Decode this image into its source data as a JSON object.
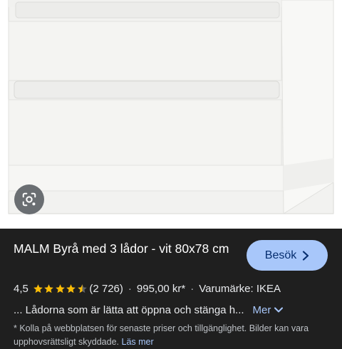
{
  "product": {
    "title": "MALM Byrå med 3 lådor - vit 80x78 cm",
    "visit_label": "Besök",
    "rating": "4,5",
    "rating_value": 4.5,
    "rating_max": 5,
    "review_count": "(2 726)",
    "separator": "·",
    "price": "995,00 kr*",
    "brand": "Varumärke: IKEA",
    "snippet": "... Lådorna som är lätta att öppna och stänga h...",
    "more_label": "Mer",
    "disclaimer": "* Kolla på webbplatsen för senaste priser och tillgänglighet. Bilder kan vara upphovsrättsligt skyddade.",
    "read_more_label": "Läs mer"
  },
  "icons": {
    "lens": "google-lens-icon",
    "visit_chevron": "chevron-right-icon",
    "more_chevron": "chevron-down-icon",
    "star": "star-icon"
  },
  "colors": {
    "panel_bg": "#1f1f1f",
    "accent": "#a8c7fa",
    "button_text": "#062e6f",
    "star": "#fbbc04"
  }
}
